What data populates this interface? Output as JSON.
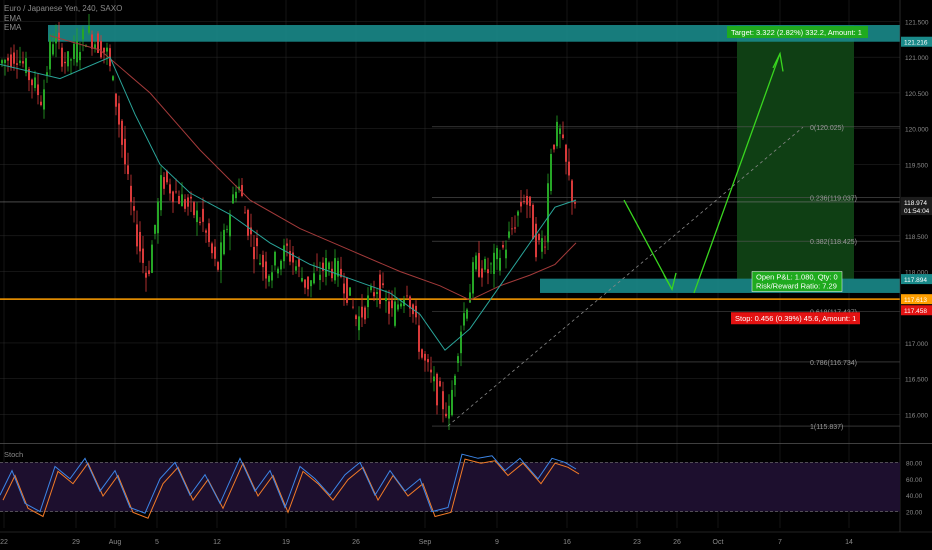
{
  "header": {
    "symbol_title": "Euro / Japanese Yen, 240, SAXO",
    "indicators": [
      "EMA",
      "EMA"
    ]
  },
  "colors": {
    "background": "#000000",
    "bull": "#26a626",
    "bear": "#d93a3a",
    "ema_fast": "#2aa59a",
    "ema_slow": "#a33a3a",
    "zone_teal": "#1a8a8a",
    "profit_zone": "#0f3f14",
    "orange_line": "#ff9e00",
    "target_label": "#1faa1f",
    "stop_label": "#e31212",
    "arrow": "#39d61f",
    "stoch_k": "#3d86e8",
    "stoch_d": "#f37b27",
    "stoch_band": "#1d0f2e",
    "grid": "#2a2a2a",
    "axis_text": "#8a8a8a"
  },
  "price_axis": {
    "ticks": [
      "121.500",
      "121.000",
      "120.500",
      "120.000",
      "119.500",
      "118.500",
      "118.000",
      "117.000",
      "116.500",
      "116.000"
    ],
    "tick_values": [
      121.5,
      121.0,
      120.5,
      120.0,
      119.5,
      118.5,
      118.0,
      117.0,
      116.5,
      116.0
    ],
    "badges": [
      {
        "label": "121.216",
        "value": 121.216,
        "color": "#1a8a8a"
      },
      {
        "label": "118.974",
        "value": 118.974,
        "color": "#1c1c1c"
      },
      {
        "label": "01:54:04",
        "value": 118.86,
        "color": "#1c1c1c"
      },
      {
        "label": "117.894",
        "value": 117.894,
        "color": "#1a8a8a"
      },
      {
        "label": "117.613",
        "value": 117.613,
        "color": "#ff9e00"
      },
      {
        "label": "117.458",
        "value": 117.458,
        "color": "#e31212"
      }
    ]
  },
  "time_axis": [
    "22",
    "29",
    "Aug",
    "5",
    "12",
    "19",
    "26",
    "Sep",
    "9",
    "16",
    "23",
    "26",
    "Oct",
    "7",
    "14"
  ],
  "fibonacci": [
    {
      "label": "0(120.025)",
      "value": 120.025
    },
    {
      "label": "0.236(119.037)",
      "value": 119.037
    },
    {
      "label": "0.382(118.425)",
      "value": 118.425
    },
    {
      "label": "0.618(117.437)",
      "value": 117.437
    },
    {
      "label": "0.786(116.734)",
      "value": 116.734
    },
    {
      "label": "1(115.837)",
      "value": 115.837
    }
  ],
  "position": {
    "target_label": "Target: 3.322 (2.82%) 332.2, Amount: 1",
    "open_pnl_label": "Open P&L: 1.080, Qty: 0",
    "risk_reward_label": "Risk/Reward Ratio: 7.29",
    "stop_label": "Stop: 0.456 (0.39%) 45.6, Amount: 1",
    "entry": 117.894,
    "target": 121.216,
    "stop": 117.458
  },
  "zones": {
    "resistance": {
      "top": 121.45,
      "bottom": 121.216
    },
    "support": {
      "top": 117.9,
      "bottom": 117.7
    },
    "orange_level": 117.613
  },
  "stochastic": {
    "label": "Stoch",
    "ticks": [
      "80.00",
      "60.00",
      "40.00",
      "20.00"
    ],
    "tick_values": [
      80,
      60,
      40,
      20
    ],
    "band": [
      20,
      80
    ]
  },
  "chart_data": {
    "type": "candlestick",
    "title": "Euro / Japanese Yen, 240, SAXO",
    "price_range": [
      115.6,
      121.8
    ],
    "price_path": [
      [
        0,
        120.9
      ],
      [
        20,
        121.05
      ],
      [
        45,
        120.4
      ],
      [
        55,
        121.3
      ],
      [
        70,
        120.9
      ],
      [
        90,
        121.35
      ],
      [
        110,
        121.05
      ],
      [
        120,
        120.3
      ],
      [
        135,
        118.8
      ],
      [
        150,
        117.9
      ],
      [
        165,
        119.3
      ],
      [
        185,
        119.0
      ],
      [
        205,
        118.7
      ],
      [
        220,
        118.0
      ],
      [
        240,
        119.3
      ],
      [
        255,
        118.4
      ],
      [
        270,
        118.0
      ],
      [
        290,
        118.3
      ],
      [
        310,
        117.8
      ],
      [
        330,
        118.1
      ],
      [
        345,
        117.95
      ],
      [
        360,
        117.3
      ],
      [
        380,
        117.8
      ],
      [
        395,
        117.4
      ],
      [
        410,
        117.8
      ],
      [
        425,
        116.8
      ],
      [
        440,
        116.3
      ],
      [
        452,
        116.0
      ],
      [
        462,
        117.1
      ],
      [
        478,
        118.1
      ],
      [
        492,
        118.0
      ],
      [
        510,
        118.4
      ],
      [
        528,
        119.1
      ],
      [
        540,
        118.3
      ],
      [
        548,
        118.5
      ],
      [
        553,
        119.7
      ],
      [
        562,
        120.0
      ],
      [
        570,
        119.4
      ],
      [
        576,
        119.0
      ]
    ],
    "ema_fast_path": [
      [
        0,
        120.9
      ],
      [
        60,
        120.7
      ],
      [
        110,
        121.0
      ],
      [
        135,
        120.2
      ],
      [
        160,
        119.5
      ],
      [
        190,
        119.1
      ],
      [
        230,
        118.8
      ],
      [
        270,
        118.4
      ],
      [
        310,
        118.1
      ],
      [
        350,
        117.9
      ],
      [
        390,
        117.7
      ],
      [
        420,
        117.4
      ],
      [
        445,
        116.9
      ],
      [
        470,
        117.2
      ],
      [
        500,
        117.8
      ],
      [
        530,
        118.4
      ],
      [
        555,
        118.9
      ],
      [
        576,
        119.0
      ]
    ],
    "ema_slow_path": [
      [
        50,
        121.3
      ],
      [
        100,
        121.1
      ],
      [
        150,
        120.5
      ],
      [
        200,
        119.7
      ],
      [
        250,
        119.0
      ],
      [
        300,
        118.6
      ],
      [
        350,
        118.3
      ],
      [
        400,
        118.0
      ],
      [
        440,
        117.8
      ],
      [
        470,
        117.6
      ],
      [
        500,
        117.8
      ],
      [
        530,
        117.95
      ],
      [
        555,
        118.1
      ],
      [
        576,
        118.4
      ]
    ],
    "stoch_range": [
      0,
      100
    ],
    "stoch_k_path": [
      [
        0,
        40
      ],
      [
        12,
        70
      ],
      [
        25,
        30
      ],
      [
        40,
        20
      ],
      [
        55,
        75
      ],
      [
        70,
        60
      ],
      [
        85,
        85
      ],
      [
        100,
        45
      ],
      [
        115,
        70
      ],
      [
        130,
        25
      ],
      [
        145,
        18
      ],
      [
        160,
        60
      ],
      [
        175,
        80
      ],
      [
        190,
        40
      ],
      [
        205,
        65
      ],
      [
        220,
        30
      ],
      [
        240,
        85
      ],
      [
        255,
        45
      ],
      [
        270,
        70
      ],
      [
        285,
        25
      ],
      [
        300,
        75
      ],
      [
        315,
        60
      ],
      [
        330,
        40
      ],
      [
        345,
        65
      ],
      [
        360,
        80
      ],
      [
        375,
        40
      ],
      [
        390,
        70
      ],
      [
        405,
        45
      ],
      [
        420,
        60
      ],
      [
        432,
        20
      ],
      [
        448,
        25
      ],
      [
        462,
        90
      ],
      [
        478,
        85
      ],
      [
        492,
        88
      ],
      [
        505,
        70
      ],
      [
        520,
        85
      ],
      [
        538,
        60
      ],
      [
        552,
        85
      ],
      [
        565,
        80
      ],
      [
        576,
        72
      ]
    ]
  }
}
